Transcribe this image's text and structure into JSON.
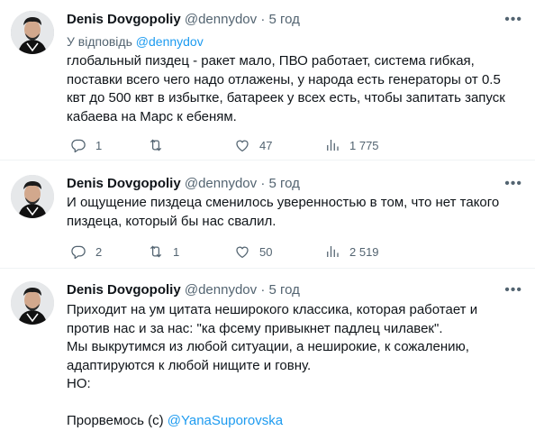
{
  "tweets": [
    {
      "name": "Denis Dovgopoliy",
      "handle": "@dennydov",
      "separator": "·",
      "time": "5 год",
      "reply_prefix": "У відповідь",
      "reply_to": "@dennydov",
      "text": "глобальный пиздец - ракет мало, ПВО работает, система гибкая, поставки всего чего надо отлажены, у народа есть генераторы от 0.5 квт до 500 квт в избытке, батареек у всех есть, чтобы запитать запуск кабаева на Марс к ебеням.",
      "replies": "1",
      "retweets": "",
      "likes": "47",
      "views": "1 775"
    },
    {
      "name": "Denis Dovgopoliy",
      "handle": "@dennydov",
      "separator": "·",
      "time": "5 год",
      "text": "И ощущение пиздеца сменилось уверенностью в том, что нет такого пиздеца, который бы нас свалил.",
      "replies": "2",
      "retweets": "1",
      "likes": "50",
      "views": "2 519"
    },
    {
      "name": "Denis Dovgopoliy",
      "handle": "@dennydov",
      "separator": "·",
      "time": "5 год",
      "lines": [
        "Приходит на ум цитата неширокого классика, которая работает и против нас и за нас: \"ка фсему привыкнет падлец чилавек\".",
        "Мы выкрутимся из любой ситуации, а неширокие, к сожалению, адаптируются к любой нищите и говну.",
        "НО:"
      ],
      "closing_prefix": "Прорвемось (с)",
      "closing_mention": "@YanaSuporovska"
    }
  ],
  "icons": {
    "reply": "reply-icon",
    "retweet": "retweet-icon",
    "like": "heart-icon",
    "views": "views-icon",
    "more": "more-icon"
  }
}
